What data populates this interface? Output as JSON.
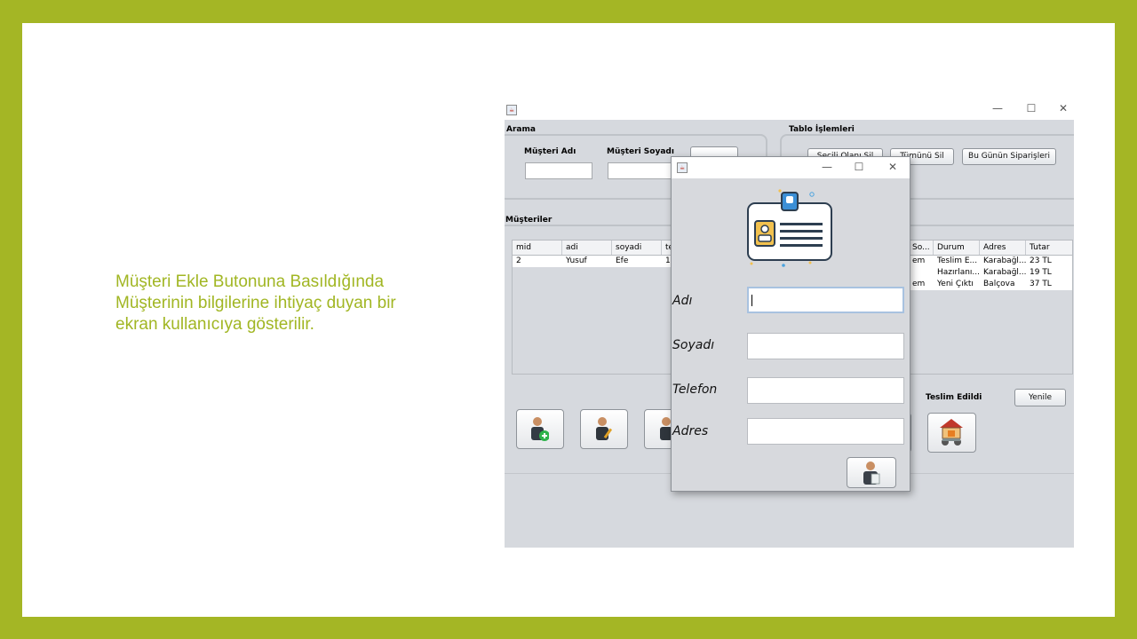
{
  "caption": {
    "lines": [
      "Müşteri Ekle Butonuna Basıldığında",
      "Müşterinin bilgilerine ihtiyaç duyan bir",
      "ekran kullanıcıya gösterilir."
    ]
  },
  "main_window": {
    "controls": {
      "minimize": "—",
      "maximize": "☐",
      "close": "✕"
    },
    "search_panel": {
      "title": "Arama",
      "first_name_label": "Müşteri Adı",
      "last_name_label": "Müşteri Soyadı",
      "first_name_value": "",
      "last_name_value": ""
    },
    "table_ops_panel": {
      "title": "Tablo İşlemleri",
      "delete_selected": "Seçili Olanı Sil",
      "delete_all": "Tümünü Sil",
      "todays_orders": "Bu Günün Siparişleri"
    },
    "customers_label": "Müşteriler",
    "left_table": {
      "columns": [
        "mid",
        "adi",
        "soyadi",
        "te"
      ],
      "rows": [
        [
          "2",
          "Yusuf",
          "Efe",
          "11"
        ]
      ]
    },
    "right_table": {
      "columns": [
        "So...",
        "Durum",
        "Adres",
        "Tutar"
      ],
      "rows": [
        [
          "em",
          "Teslim E...",
          "Karabağl...",
          "23 TL"
        ],
        [
          "",
          "Hazırlanı...",
          "Karabağl...",
          "19 TL"
        ],
        [
          "em",
          "Yeni Çıktı",
          "Balçova",
          "37 TL"
        ]
      ]
    },
    "delivered_label": "Teslim Edildi",
    "refresh_button": "Yenile",
    "icons": {
      "add_customer": "add-customer-icon",
      "edit_customer": "edit-customer-icon",
      "delivery": "delivery-scooter-icon"
    }
  },
  "dialog": {
    "controls": {
      "minimize": "—",
      "maximize": "☐",
      "close": "✕"
    },
    "header_icon": "id-card-icon",
    "fields": [
      {
        "label": "Adı",
        "value": ""
      },
      {
        "label": "Soyadı",
        "value": ""
      },
      {
        "label": "Telefon",
        "value": ""
      },
      {
        "label": "Adres",
        "value": ""
      }
    ],
    "save_icon": "save-customer-icon"
  }
}
